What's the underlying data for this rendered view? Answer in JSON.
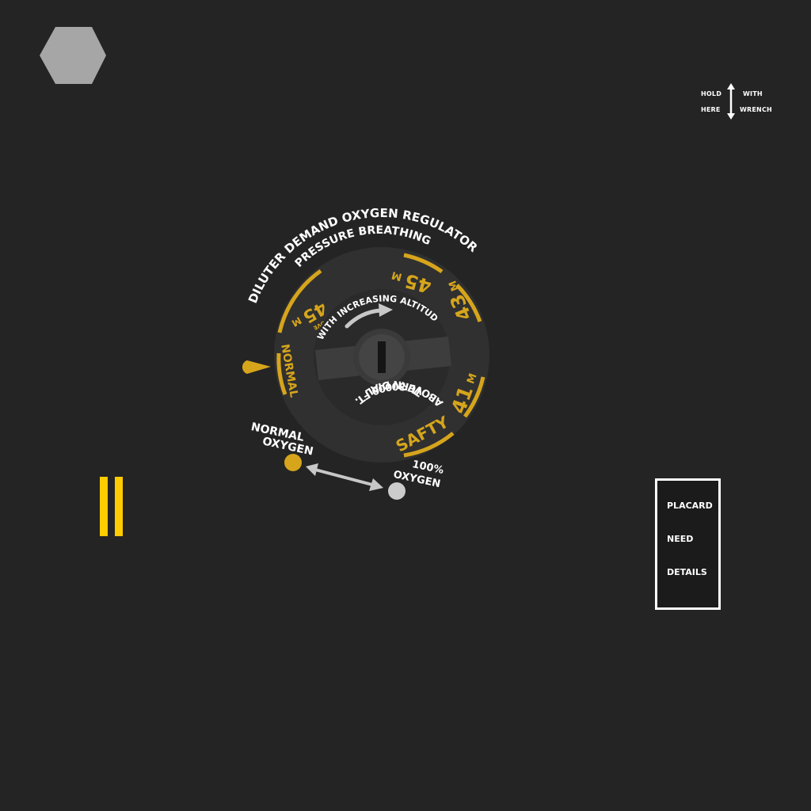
{
  "colors": {
    "background": "#242424",
    "dial_face": "#303030",
    "accent_yellow": "#d6a51c",
    "bright_yellow": "#ffcc00",
    "text_white": "#ffffff",
    "grey": "#c8c8c8",
    "bolt_grey": "#a6a6a6"
  },
  "bolt": {
    "icon": "hex-bolt-icon"
  },
  "wrench_hint": {
    "hold": "HOLD",
    "here": "HERE",
    "with": "WITH",
    "wrench": "WRENCH",
    "icon": "double-arrow-vertical-icon"
  },
  "regulator": {
    "title": "DILUTER DEMAND OXYGEN REGULATOR",
    "subtitle": "PRESSURE BREATHING",
    "scale_45_above": "45",
    "scale_45_above_unit": "M",
    "scale_above_word": "ABOVE",
    "scale_45": "45",
    "scale_45_unit": "M",
    "scale_43": "43",
    "scale_43_unit": "M",
    "scale_41": "41",
    "scale_41_unit": "M",
    "normal_label": "NORMAL",
    "safety_label": "SAFTY",
    "inner_top": "WITH INCREASING ALTITUDE",
    "inner_bottom_1": "TURN DIAL",
    "inner_bottom_2": "ABOVE 30000 FT.",
    "normal_oxygen_1": "NORMAL",
    "normal_oxygen_2": "OXYGEN",
    "full_oxygen_1": "100%",
    "full_oxygen_2": "OXYGEN",
    "pointer_icon": "dial-pointer-icon",
    "rotate_arrow_icon": "curved-arrow-icon",
    "lever_arrow_icon": "double-arrow-icon"
  },
  "pause": {
    "icon": "pause-icon"
  },
  "placard": {
    "line1": "PLACARD",
    "line2": "NEED",
    "line3": "DETAILS"
  }
}
